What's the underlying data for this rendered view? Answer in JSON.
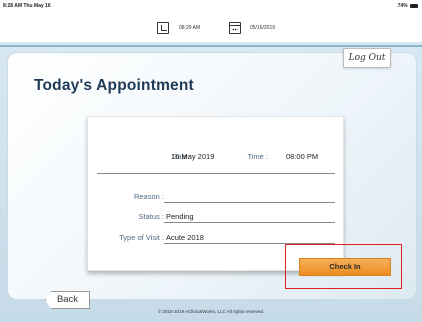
{
  "status_bar": {
    "time": "8:28 AM  Thu May 16",
    "battery": "74%"
  },
  "toolbar": {
    "time": "08:29 AM",
    "date": "05/16/2019"
  },
  "header": {
    "logout_label": "Log Out"
  },
  "page": {
    "title": "Today's Appointment"
  },
  "appointment": {
    "date_label": "Date :",
    "date_value": "16 May 2019",
    "time_label": "Time :",
    "time_value": "08:00 PM",
    "reason_label": "Reason :",
    "reason_value": "",
    "status_label": "Status :",
    "status_value": "Pending",
    "visit_label": "Type of Visit :",
    "visit_value": "Acute 2018"
  },
  "actions": {
    "checkin_label": "Check In",
    "back_label": "Back"
  },
  "footer": {
    "copyright": "© 2015-2019 eClinicalWorks, LLC All rights reserved."
  },
  "colors": {
    "accent": "#ec8b1f",
    "highlight": "#e02020",
    "title": "#1f3a56"
  }
}
